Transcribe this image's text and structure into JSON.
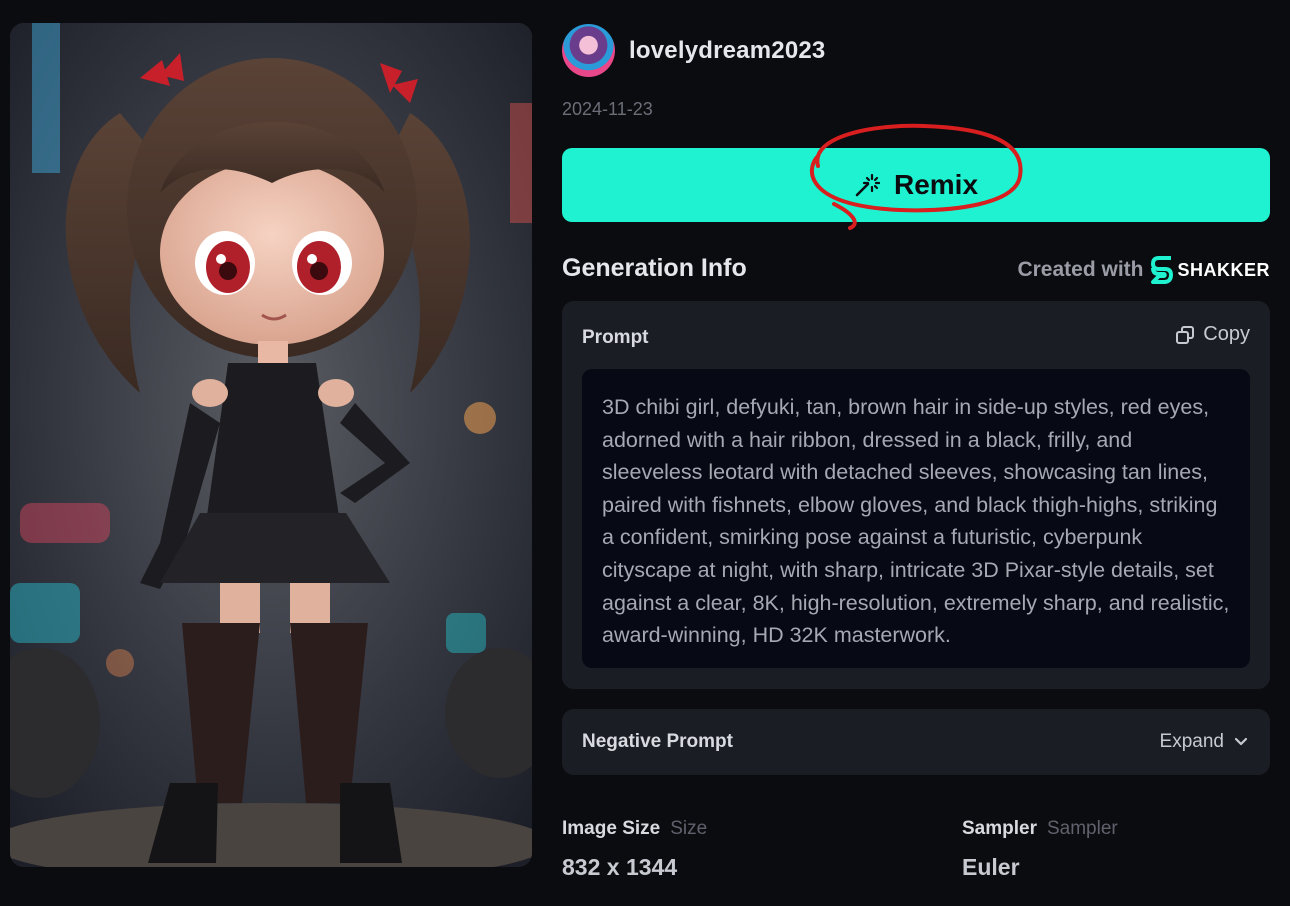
{
  "author": {
    "username": "lovelydream2023",
    "date": "2024-11-23"
  },
  "remix": {
    "label": "Remix"
  },
  "generation_info": {
    "title": "Generation Info",
    "created_with": "Created with",
    "brand": "SHAKKER"
  },
  "prompt": {
    "title": "Prompt",
    "copy_label": "Copy",
    "text": "3D chibi girl, defyuki, tan, brown hair in side-up styles, red eyes, adorned with a hair ribbon, dressed in a black, frilly, and sleeveless leotard with detached sleeves, showcasing tan lines, paired with fishnets, elbow gloves, and black thigh-highs, striking a confident, smirking pose against a futuristic, cyberpunk cityscape at night, with sharp, intricate 3D Pixar-style details, set against a clear, 8K, high-resolution, extremely sharp, and realistic, award-winning, HD 32K masterwork."
  },
  "negative_prompt": {
    "title": "Negative Prompt",
    "expand_label": "Expand"
  },
  "params": {
    "image_size": {
      "label": "Image Size",
      "sub": "Size",
      "value": "832 x 1344"
    },
    "sampler": {
      "label": "Sampler",
      "sub": "Sampler",
      "value": "Euler"
    }
  },
  "colors": {
    "accent": "#1ff2d0",
    "background": "#0b0c10",
    "card": "#1b1d24",
    "annotation": "#d81e1e"
  },
  "icons": [
    "magic-wand-icon",
    "copy-icon",
    "chevron-down-icon",
    "shakker-logo-icon"
  ]
}
